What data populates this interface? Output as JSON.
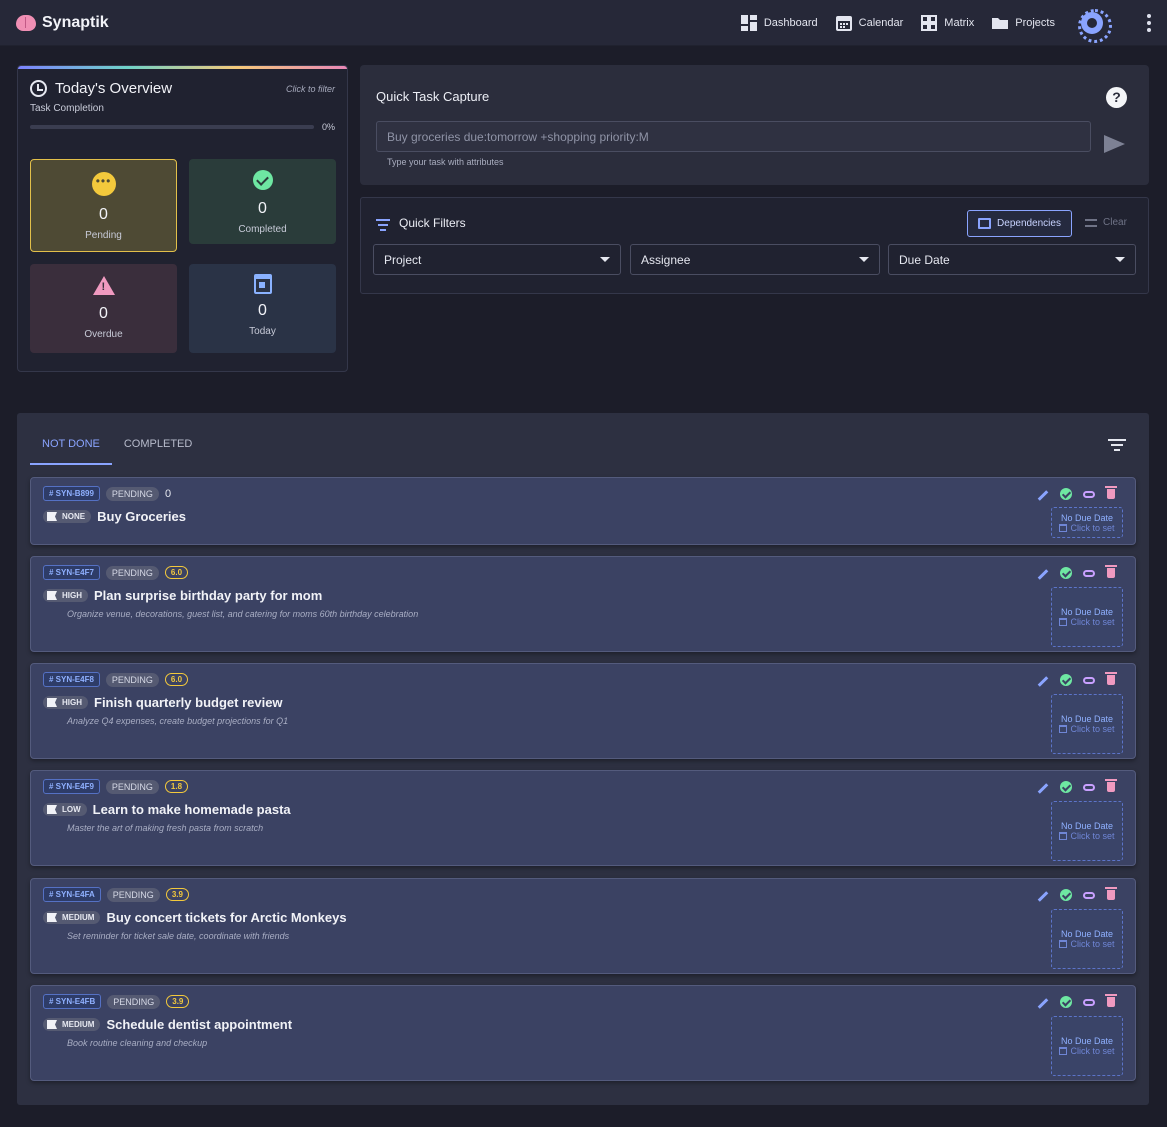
{
  "app": {
    "name": "Synaptik"
  },
  "nav": {
    "items": [
      {
        "label": "Dashboard",
        "icon": "dashboard-icon"
      },
      {
        "label": "Calendar",
        "icon": "calendar-icon"
      },
      {
        "label": "Matrix",
        "icon": "matrix-icon"
      },
      {
        "label": "Projects",
        "icon": "folder-icon"
      }
    ]
  },
  "overview": {
    "title": "Today's Overview",
    "hint": "Click to filter",
    "completion_label": "Task Completion",
    "completion_value": "0%",
    "completion_fraction": 0,
    "stats": {
      "pending": {
        "value": "0",
        "label": "Pending"
      },
      "completed": {
        "value": "0",
        "label": "Completed"
      },
      "overdue": {
        "value": "0",
        "label": "Overdue"
      },
      "today": {
        "value": "0",
        "label": "Today"
      }
    }
  },
  "capture": {
    "title": "Quick Task Capture",
    "help": "?",
    "placeholder": "Buy groceries due:tomorrow +shopping priority:M",
    "hint": "Type your task with attributes"
  },
  "filters": {
    "title": "Quick Filters",
    "dependencies_label": "Dependencies",
    "clear_label": "Clear",
    "project": "Project",
    "assignee": "Assignee",
    "due_date": "Due Date"
  },
  "tabs": {
    "not_done": "NOT DONE",
    "completed": "COMPLETED"
  },
  "tasks": [
    {
      "id": "SYN-B899",
      "status": "PENDING",
      "score": "0",
      "priority": "NONE",
      "title": "Buy Groceries",
      "description": "",
      "due": "No Due Date",
      "due_action": "Click to set"
    },
    {
      "id": "SYN-E4F7",
      "status": "PENDING",
      "score": "6.0",
      "priority": "HIGH",
      "title": "Plan surprise birthday party for mom",
      "description": "Organize venue, decorations, guest list, and catering for moms 60th birthday celebration",
      "due": "No Due Date",
      "due_action": "Click to set"
    },
    {
      "id": "SYN-E4F8",
      "status": "PENDING",
      "score": "6.0",
      "priority": "HIGH",
      "title": "Finish quarterly budget review",
      "description": "Analyze Q4 expenses, create budget projections for Q1",
      "due": "No Due Date",
      "due_action": "Click to set"
    },
    {
      "id": "SYN-E4F9",
      "status": "PENDING",
      "score": "1.8",
      "priority": "LOW",
      "title": "Learn to make homemade pasta",
      "description": "Master the art of making fresh pasta from scratch",
      "due": "No Due Date",
      "due_action": "Click to set"
    },
    {
      "id": "SYN-E4FA",
      "status": "PENDING",
      "score": "3.9",
      "priority": "MEDIUM",
      "title": "Buy concert tickets for Arctic Monkeys",
      "description": "Set reminder for ticket sale date, coordinate with friends",
      "due": "No Due Date",
      "due_action": "Click to set"
    },
    {
      "id": "SYN-E4FB",
      "status": "PENDING",
      "score": "3.9",
      "priority": "MEDIUM",
      "title": "Schedule dentist appointment",
      "description": "Book routine cleaning and checkup",
      "due": "No Due Date",
      "due_action": "Click to set"
    }
  ],
  "colors": {
    "accent": "#8aa4ff",
    "success": "#6ee7a2",
    "warning": "#f3c93c",
    "danger": "#f09ac0"
  }
}
